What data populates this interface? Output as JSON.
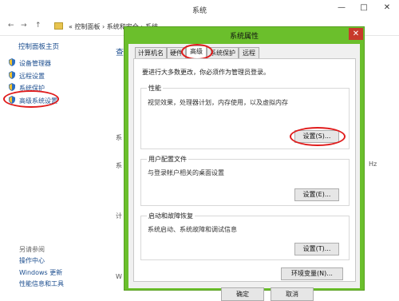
{
  "window": {
    "title": "系统",
    "controls": {
      "minimize": "—",
      "maximize": "□",
      "close": "✕"
    }
  },
  "addressbar": {
    "back": "←",
    "forward": "→",
    "up": "↑",
    "breadcrumb": "« 控制面板 › 系统和安全 › 系统"
  },
  "leftpane": {
    "home": "控制面板主页",
    "links": [
      "设备管理器",
      "远程设置",
      "系统保护",
      "高级系统设置"
    ],
    "see_also": "另请参阅",
    "bottom_links": [
      "操作中心",
      "Windows 更新",
      "性能信息和工具"
    ]
  },
  "main_fragments": [
    "查",
    "系",
    "系",
    "计",
    "W",
    "Hz"
  ],
  "dialog": {
    "title": "系统属性",
    "close": "✕",
    "tabs": [
      "计算机名",
      "硬件",
      "高级",
      "系统保护",
      "远程"
    ],
    "admin_note": "要进行大多数更改，你必须作为管理员登录。",
    "performance": {
      "legend": "性能",
      "desc": "视觉效果，处理器计划，内存使用，以及虚拟内存",
      "button": "设置(S)..."
    },
    "user_profiles": {
      "legend": "用户配置文件",
      "desc": "与登录帐户相关的桌面设置",
      "button": "设置(E)..."
    },
    "startup": {
      "legend": "启动和故障恢复",
      "desc": "系统启动、系统故障和调试信息",
      "button": "设置(T)..."
    },
    "env_button": "环境变量(N)...",
    "ok": "确定",
    "cancel": "取消"
  },
  "colors": {
    "dialog_frame": "#6bbf2c",
    "highlight": "#e01c1c",
    "link": "#1c4e8f"
  }
}
